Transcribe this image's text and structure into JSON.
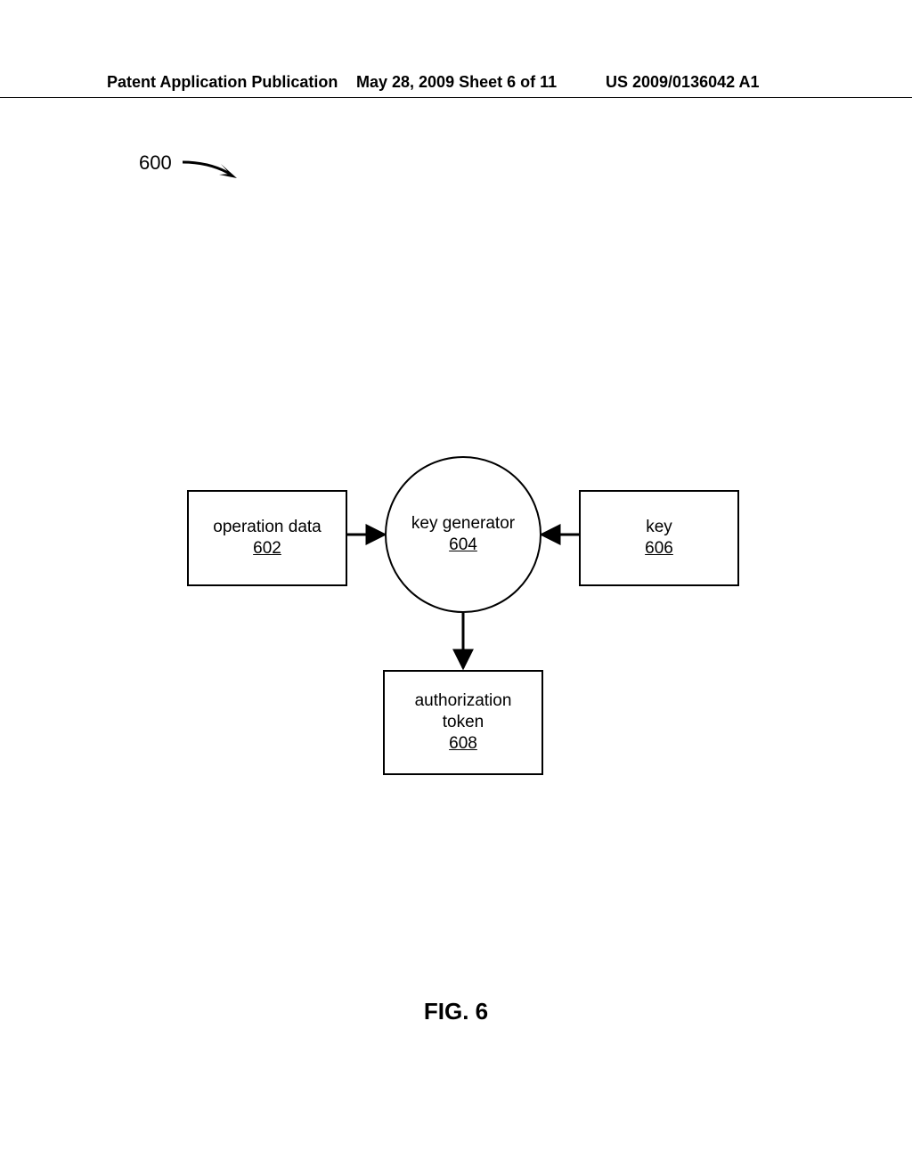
{
  "header": {
    "left": "Patent Application Publication",
    "mid": "May 28, 2009  Sheet 6 of 11",
    "right": "US 2009/0136042 A1"
  },
  "figure_ref": "600",
  "nodes": {
    "opdata": {
      "label": "operation data",
      "num": "602"
    },
    "keygen": {
      "label": "key generator",
      "num": "604"
    },
    "key": {
      "label": "key",
      "num": "606"
    },
    "auth": {
      "label1": "authorization",
      "label2": "token",
      "num": "608"
    }
  },
  "caption": "FIG. 6"
}
